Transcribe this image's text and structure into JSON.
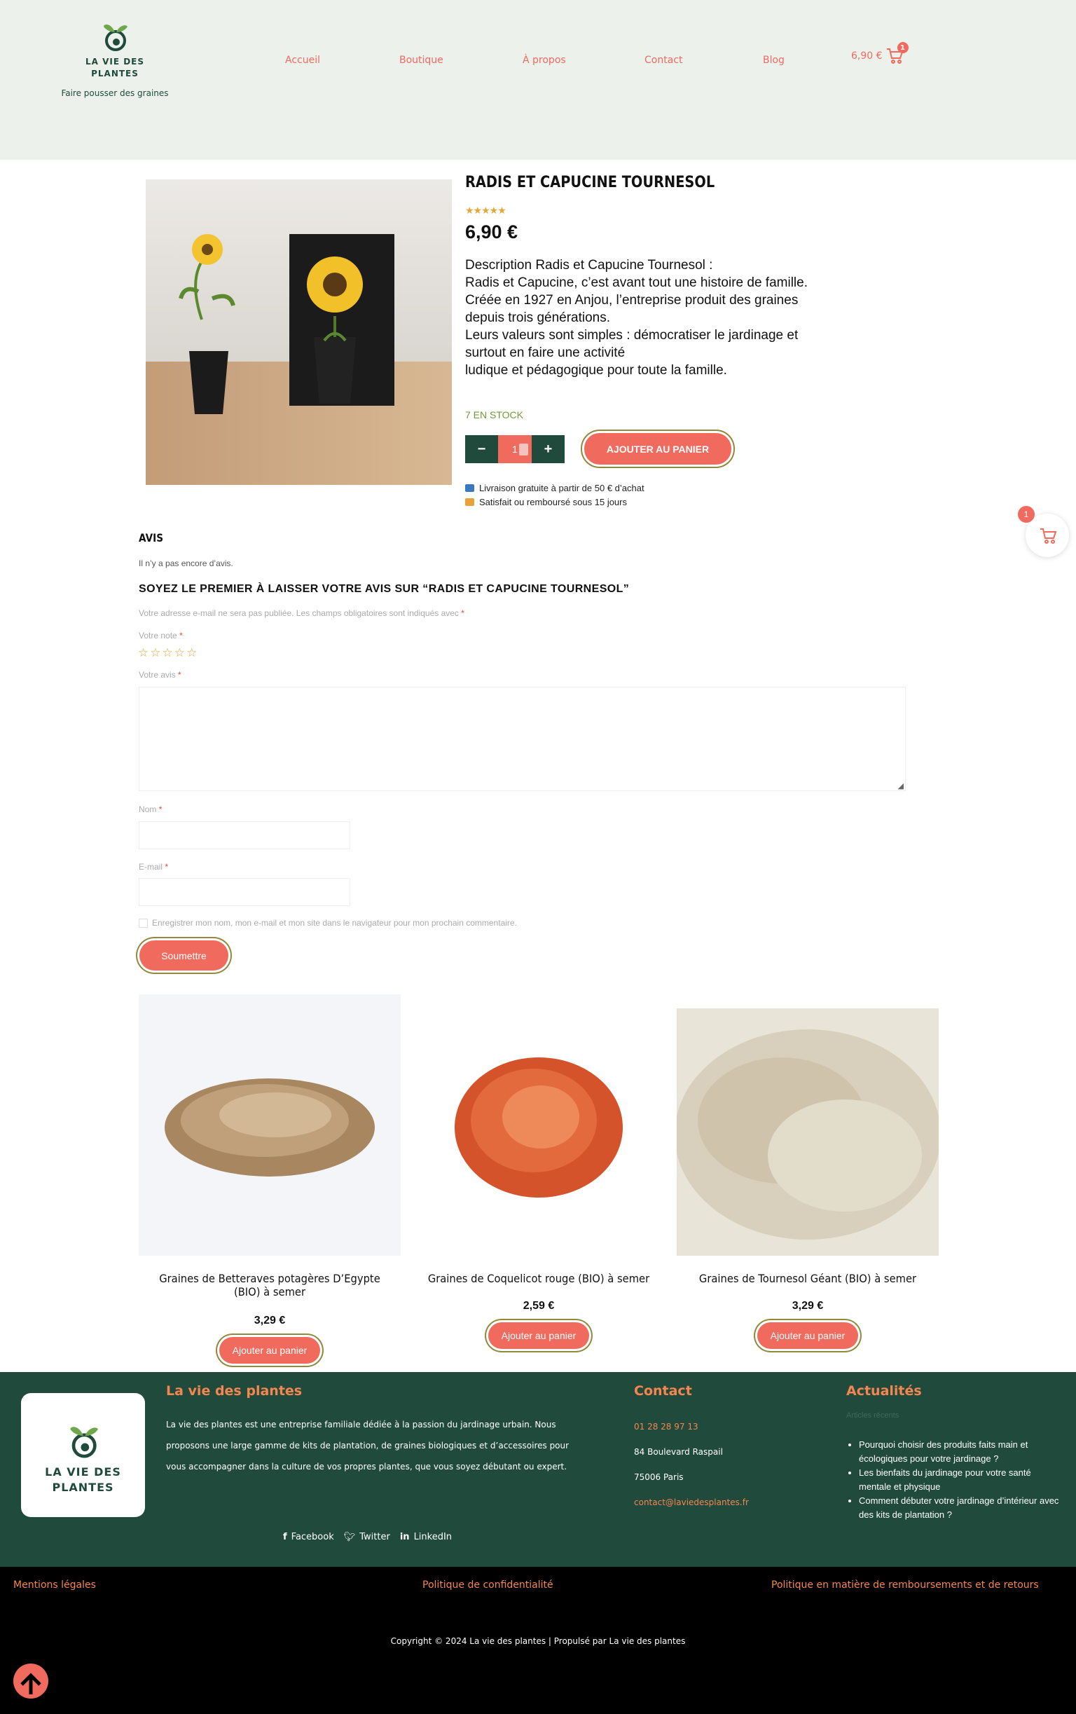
{
  "header": {
    "logo_line1": "LA VIE DES",
    "logo_line2": "PLANTES",
    "tagline": "Faire pousser des graines",
    "nav": [
      {
        "label": "Accueil"
      },
      {
        "label": "Boutique"
      },
      {
        "label": "À propos"
      },
      {
        "label": "Contact"
      },
      {
        "label": "Blog"
      }
    ],
    "cart_total": "6,90 €",
    "cart_count": "1"
  },
  "product": {
    "title": "RADIS ET CAPUCINE TOURNESOL",
    "rating": 5,
    "price": "6,90 €",
    "description": [
      "Description Radis et Capucine Tournesol :",
      "Radis et Capucine, c’est avant tout une histoire de famille. Créée en 1927 en Anjou, l’entreprise produit des graines depuis trois générations.",
      "Leurs valeurs sont simples : démocratiser le jardinage et surtout en faire une activité",
      "ludique et pédagogique pour toute la famille."
    ],
    "stock": "7 EN STOCK",
    "quantity": "1",
    "qty_minus": "−",
    "qty_plus": "+",
    "add_to_cart": "AJOUTER AU PANIER",
    "info_delivery": "Livraison gratuite à partir de 50 € d’achat",
    "info_refund": "Satisfait ou remboursé sous 15 jours"
  },
  "floating_cart": {
    "count": "1"
  },
  "reviews": {
    "heading": "AVIS",
    "empty": "Il n’y a pas encore d’avis.",
    "form_title": "SOYEZ LE PREMIER À LAISSER VOTRE AVIS SUR “RADIS ET CAPUCINE TOURNESOL”",
    "notice": "Votre adresse e-mail ne sera pas publiée. Les champs obligatoires sont indiqués avec",
    "required_mark": "*",
    "rating_label": "Votre note",
    "review_label": "Votre avis",
    "name_label": "Nom",
    "email_label": "E-mail",
    "save_label": "Enregistrer mon nom, mon e-mail et mon site dans le navigateur pour mon prochain commentaire.",
    "submit": "Soumettre"
  },
  "related": [
    {
      "title": "Graines de Betteraves potagères D’Egypte (BIO) à semer",
      "price": "3,29 €",
      "button": "Ajouter au panier"
    },
    {
      "title": "Graines de Coquelicot rouge (BIO) à semer",
      "price": "2,59 €",
      "button": "Ajouter au panier"
    },
    {
      "title": "Graines de Tournesol Géant (BIO) à semer",
      "price": "3,29 €",
      "button": "Ajouter au panier"
    }
  ],
  "footer": {
    "logo_line1": "LA VIE DES",
    "logo_line2": "PLANTES",
    "about_title": "La vie des plantes",
    "about_text": "La vie des plantes est une entreprise familiale dédiée à la passion du jardinage urbain. Nous proposons une large gamme de kits de plantation, de graines biologiques et d’accessoires pour vous accompagner dans la culture de vos propres plantes, que vous soyez débutant ou expert.",
    "social": [
      {
        "label": "Facebook",
        "icon": "facebook-icon"
      },
      {
        "label": "Twitter",
        "icon": "twitter-icon"
      },
      {
        "label": "LinkedIn",
        "icon": "linkedin-icon"
      }
    ],
    "contact_title": "Contact",
    "phone": "01 28 28 97 13",
    "address1": "84 Boulevard Raspail",
    "address2": "75006  Paris",
    "email": "contact@laviedesplantes.fr",
    "news_title": "Actualités",
    "news_sub": "Articles récents",
    "news": [
      "Pourquoi choisir des produits faits main et écologiques pour votre jardinage ?",
      "Les bienfaits du jardinage pour votre santé mentale et physique",
      "Comment débuter votre jardinage d’intérieur avec des kits de plantation ?"
    ]
  },
  "legal": {
    "mentions": "Mentions légales",
    "privacy": "Politique de confidentialité",
    "refund": "Politique en matière de remboursements et de retours",
    "copyright": "Copyright © 2024 La vie des plantes | Propulsé par La vie des plantes"
  },
  "colors": {
    "accent": "#f06a5d",
    "green": "#1f4a3c",
    "header_bg": "#edf1ec",
    "stock": "#6f9a39",
    "footer_accent": "#f5864f"
  }
}
